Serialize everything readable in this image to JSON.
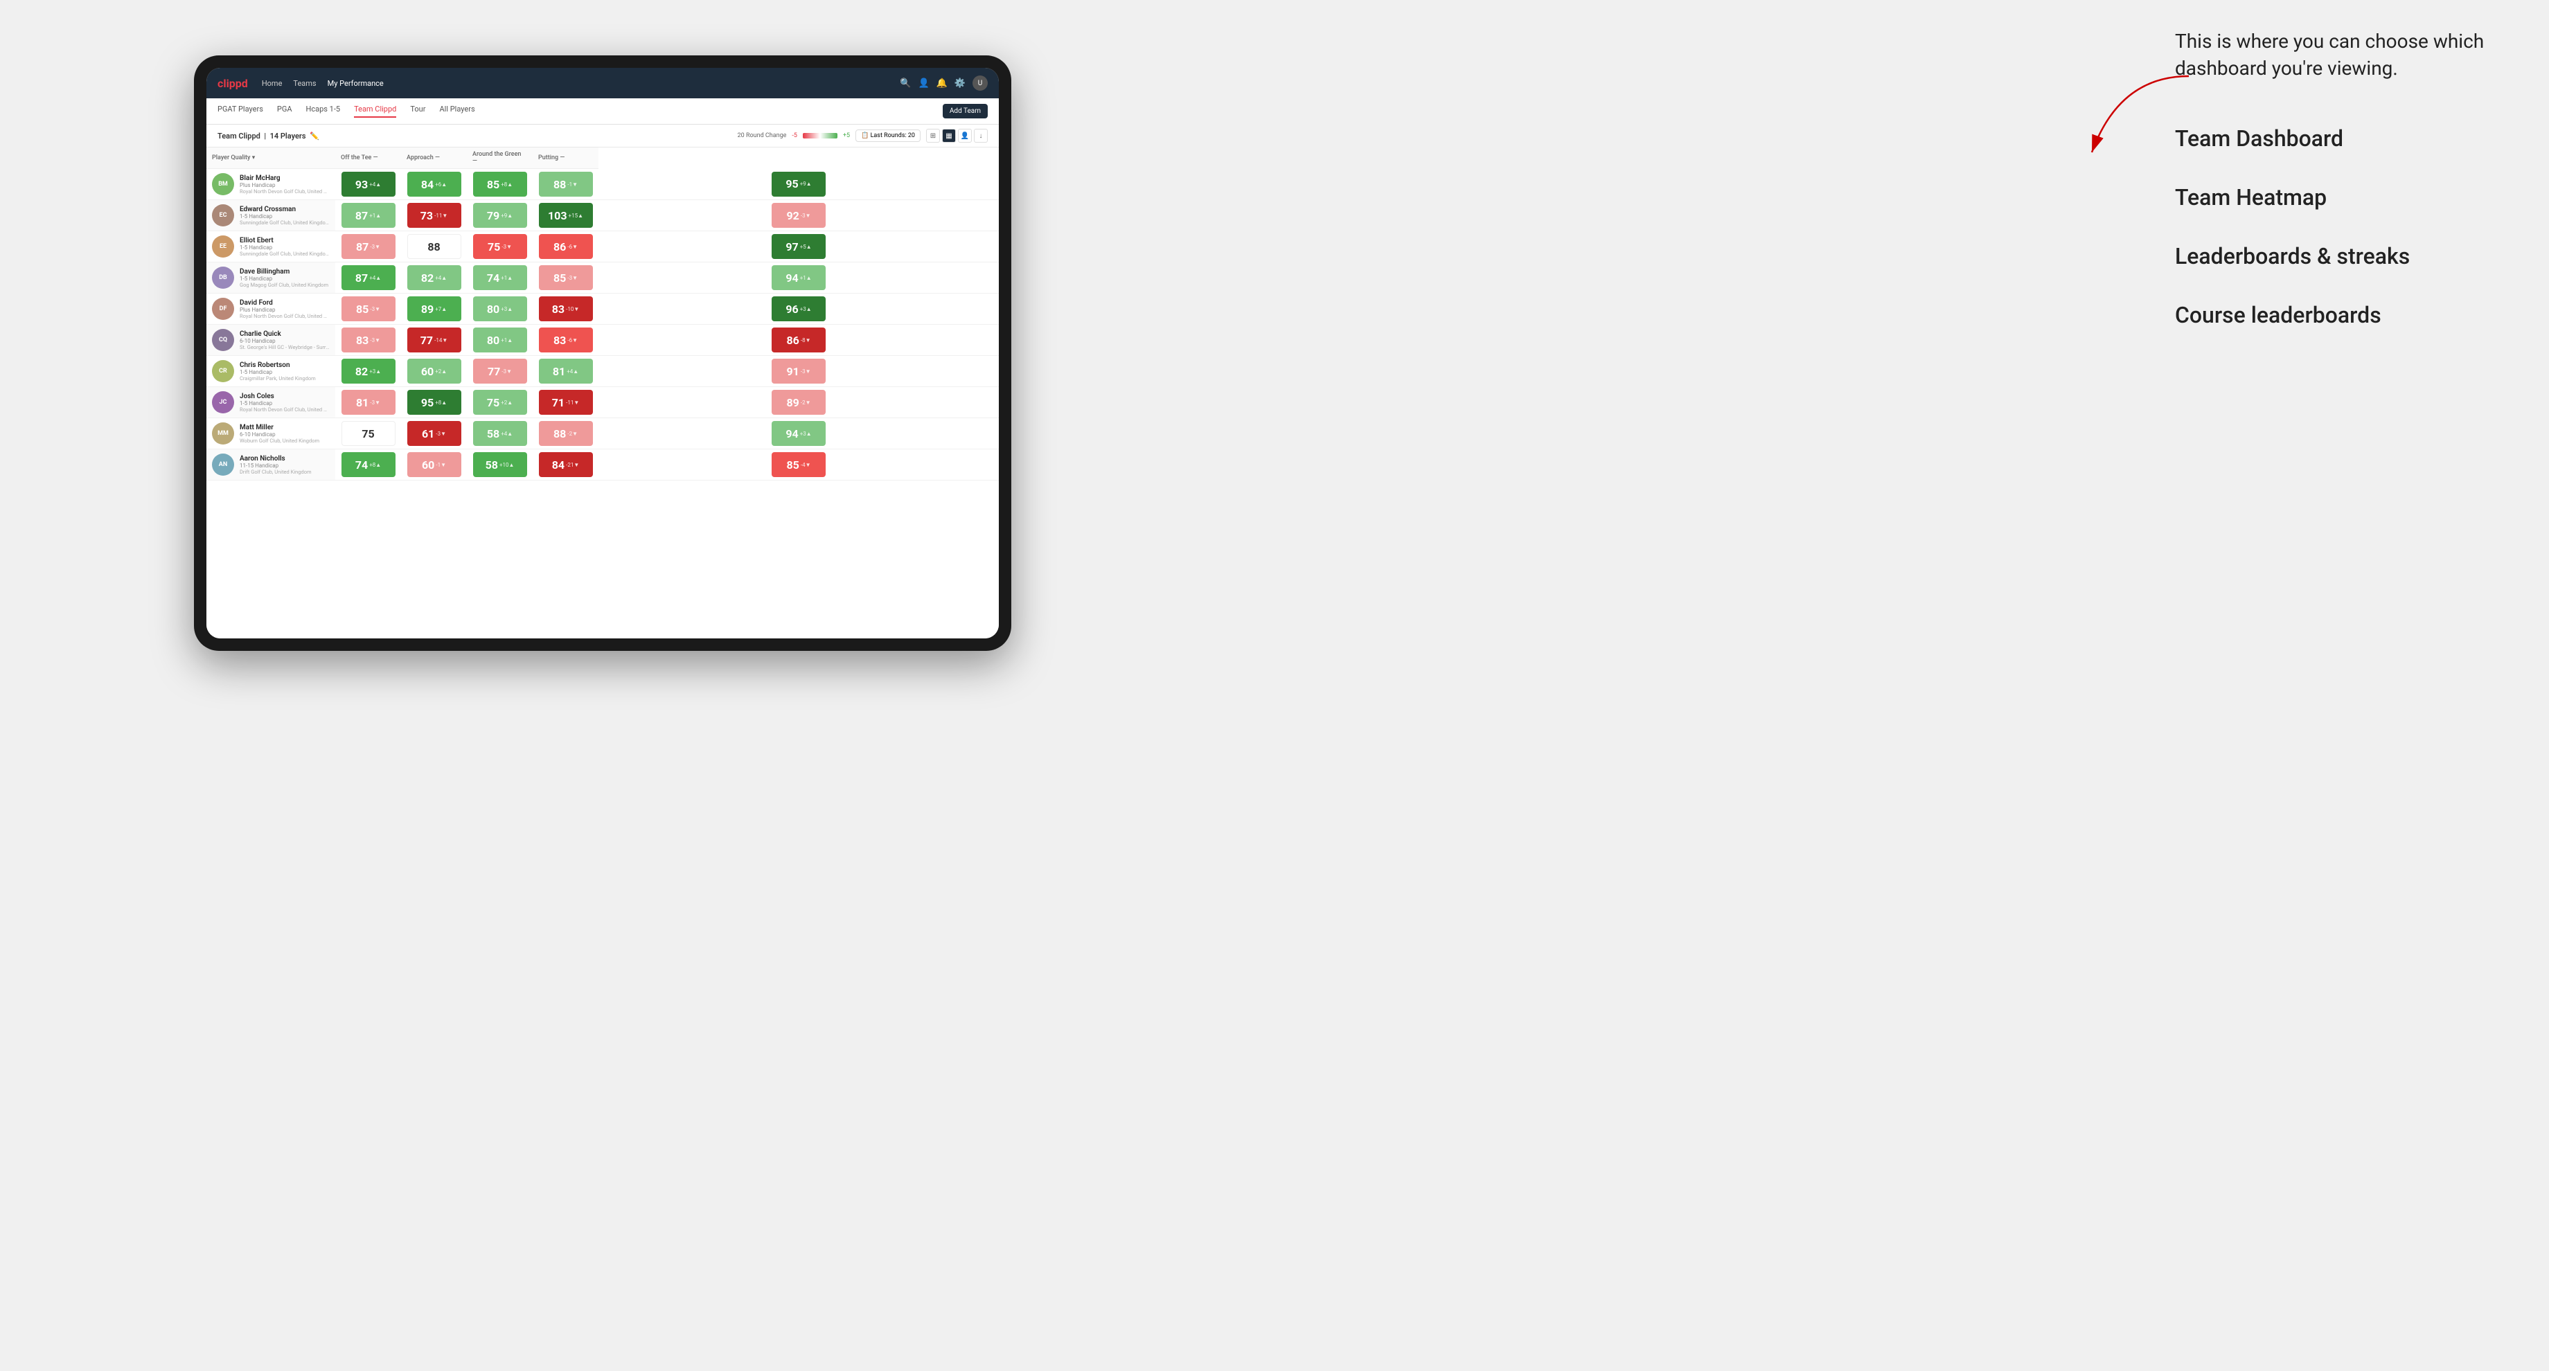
{
  "annotation": {
    "intro": "This is where you can choose which dashboard you're viewing.",
    "menu_items": [
      "Team Dashboard",
      "Team Heatmap",
      "Leaderboards & streaks",
      "Course leaderboards"
    ]
  },
  "nav": {
    "logo": "clippd",
    "links": [
      "Home",
      "Teams",
      "My Performance"
    ],
    "active_link": "My Performance"
  },
  "sub_nav": {
    "links": [
      "PGAT Players",
      "PGA",
      "Hcaps 1-5",
      "Team Clippd",
      "Tour",
      "All Players"
    ],
    "active_link": "Team Clippd",
    "add_team_label": "Add Team"
  },
  "team_header": {
    "title": "Team Clippd",
    "player_count": "14 Players",
    "round_change_label": "20 Round Change",
    "minus_val": "-5",
    "plus_val": "+5",
    "last_rounds_label": "Last Rounds:",
    "last_rounds_val": "20"
  },
  "table": {
    "columns": {
      "player": "Player Quality",
      "off_tee": "Off the Tee",
      "approach": "Approach",
      "around_green": "Around the Green",
      "putting": "Putting"
    },
    "rows": [
      {
        "name": "Blair McHarg",
        "handicap": "Plus Handicap",
        "club": "Royal North Devon Golf Club, United Kingdom",
        "scores": {
          "quality": {
            "val": 93,
            "change": "+4",
            "dir": "up",
            "color": "green-dark"
          },
          "off_tee": {
            "val": 84,
            "change": "+6",
            "dir": "up",
            "color": "green-med"
          },
          "approach": {
            "val": 85,
            "change": "+8",
            "dir": "up",
            "color": "green-med"
          },
          "around_green": {
            "val": 88,
            "change": "-1",
            "dir": "down",
            "color": "green-light"
          },
          "putting": {
            "val": 95,
            "change": "+9",
            "dir": "up",
            "color": "green-dark"
          }
        }
      },
      {
        "name": "Edward Crossman",
        "handicap": "1-5 Handicap",
        "club": "Sunningdale Golf Club, United Kingdom",
        "scores": {
          "quality": {
            "val": 87,
            "change": "+1",
            "dir": "up",
            "color": "green-light"
          },
          "off_tee": {
            "val": 73,
            "change": "-11",
            "dir": "down",
            "color": "red-dark"
          },
          "approach": {
            "val": 79,
            "change": "+9",
            "dir": "up",
            "color": "green-light"
          },
          "around_green": {
            "val": 103,
            "change": "+15",
            "dir": "up",
            "color": "green-dark"
          },
          "putting": {
            "val": 92,
            "change": "-3",
            "dir": "down",
            "color": "red-light"
          }
        }
      },
      {
        "name": "Elliot Ebert",
        "handicap": "1-5 Handicap",
        "club": "Sunningdale Golf Club, United Kingdom",
        "scores": {
          "quality": {
            "val": 87,
            "change": "-3",
            "dir": "down",
            "color": "red-light"
          },
          "off_tee": {
            "val": 88,
            "change": "",
            "dir": "none",
            "color": "white"
          },
          "approach": {
            "val": 75,
            "change": "-3",
            "dir": "down",
            "color": "red-med"
          },
          "around_green": {
            "val": 86,
            "change": "-6",
            "dir": "down",
            "color": "red-med"
          },
          "putting": {
            "val": 97,
            "change": "+5",
            "dir": "up",
            "color": "green-dark"
          }
        }
      },
      {
        "name": "Dave Billingham",
        "handicap": "1-5 Handicap",
        "club": "Gog Magog Golf Club, United Kingdom",
        "scores": {
          "quality": {
            "val": 87,
            "change": "+4",
            "dir": "up",
            "color": "green-med"
          },
          "off_tee": {
            "val": 82,
            "change": "+4",
            "dir": "up",
            "color": "green-light"
          },
          "approach": {
            "val": 74,
            "change": "+1",
            "dir": "up",
            "color": "green-light"
          },
          "around_green": {
            "val": 85,
            "change": "-3",
            "dir": "down",
            "color": "red-light"
          },
          "putting": {
            "val": 94,
            "change": "+1",
            "dir": "up",
            "color": "green-light"
          }
        }
      },
      {
        "name": "David Ford",
        "handicap": "Plus Handicap",
        "club": "Royal North Devon Golf Club, United Kingdom",
        "scores": {
          "quality": {
            "val": 85,
            "change": "-3",
            "dir": "down",
            "color": "red-light"
          },
          "off_tee": {
            "val": 89,
            "change": "+7",
            "dir": "up",
            "color": "green-med"
          },
          "approach": {
            "val": 80,
            "change": "+3",
            "dir": "up",
            "color": "green-light"
          },
          "around_green": {
            "val": 83,
            "change": "-10",
            "dir": "down",
            "color": "red-dark"
          },
          "putting": {
            "val": 96,
            "change": "+3",
            "dir": "up",
            "color": "green-dark"
          }
        }
      },
      {
        "name": "Charlie Quick",
        "handicap": "6-10 Handicap",
        "club": "St. George's Hill GC - Weybridge - Surrey, Uni...",
        "scores": {
          "quality": {
            "val": 83,
            "change": "-3",
            "dir": "down",
            "color": "red-light"
          },
          "off_tee": {
            "val": 77,
            "change": "-14",
            "dir": "down",
            "color": "red-dark"
          },
          "approach": {
            "val": 80,
            "change": "+1",
            "dir": "up",
            "color": "green-light"
          },
          "around_green": {
            "val": 83,
            "change": "-6",
            "dir": "down",
            "color": "red-med"
          },
          "putting": {
            "val": 86,
            "change": "-8",
            "dir": "down",
            "color": "red-dark"
          }
        }
      },
      {
        "name": "Chris Robertson",
        "handicap": "1-5 Handicap",
        "club": "Craigmillar Park, United Kingdom",
        "scores": {
          "quality": {
            "val": 82,
            "change": "+3",
            "dir": "up",
            "color": "green-med"
          },
          "off_tee": {
            "val": 60,
            "change": "+2",
            "dir": "up",
            "color": "green-light"
          },
          "approach": {
            "val": 77,
            "change": "-3",
            "dir": "down",
            "color": "red-light"
          },
          "around_green": {
            "val": 81,
            "change": "+4",
            "dir": "up",
            "color": "green-light"
          },
          "putting": {
            "val": 91,
            "change": "-3",
            "dir": "down",
            "color": "red-light"
          }
        }
      },
      {
        "name": "Josh Coles",
        "handicap": "1-5 Handicap",
        "club": "Royal North Devon Golf Club, United Kingdom",
        "scores": {
          "quality": {
            "val": 81,
            "change": "-3",
            "dir": "down",
            "color": "red-light"
          },
          "off_tee": {
            "val": 95,
            "change": "+8",
            "dir": "up",
            "color": "green-dark"
          },
          "approach": {
            "val": 75,
            "change": "+2",
            "dir": "up",
            "color": "green-light"
          },
          "around_green": {
            "val": 71,
            "change": "-11",
            "dir": "down",
            "color": "red-dark"
          },
          "putting": {
            "val": 89,
            "change": "-2",
            "dir": "down",
            "color": "red-light"
          }
        }
      },
      {
        "name": "Matt Miller",
        "handicap": "6-10 Handicap",
        "club": "Woburn Golf Club, United Kingdom",
        "scores": {
          "quality": {
            "val": 75,
            "change": "",
            "dir": "none",
            "color": "white"
          },
          "off_tee": {
            "val": 61,
            "change": "-3",
            "dir": "down",
            "color": "red-dark"
          },
          "approach": {
            "val": 58,
            "change": "+4",
            "dir": "up",
            "color": "green-light"
          },
          "around_green": {
            "val": 88,
            "change": "-2",
            "dir": "down",
            "color": "red-light"
          },
          "putting": {
            "val": 94,
            "change": "+3",
            "dir": "up",
            "color": "green-light"
          }
        }
      },
      {
        "name": "Aaron Nicholls",
        "handicap": "11-15 Handicap",
        "club": "Drift Golf Club, United Kingdom",
        "scores": {
          "quality": {
            "val": 74,
            "change": "+8",
            "dir": "up",
            "color": "green-med"
          },
          "off_tee": {
            "val": 60,
            "change": "-1",
            "dir": "down",
            "color": "red-light"
          },
          "approach": {
            "val": 58,
            "change": "+10",
            "dir": "up",
            "color": "green-med"
          },
          "around_green": {
            "val": 84,
            "change": "-21",
            "dir": "down",
            "color": "red-dark"
          },
          "putting": {
            "val": 85,
            "change": "-4",
            "dir": "down",
            "color": "red-med"
          }
        }
      }
    ]
  }
}
